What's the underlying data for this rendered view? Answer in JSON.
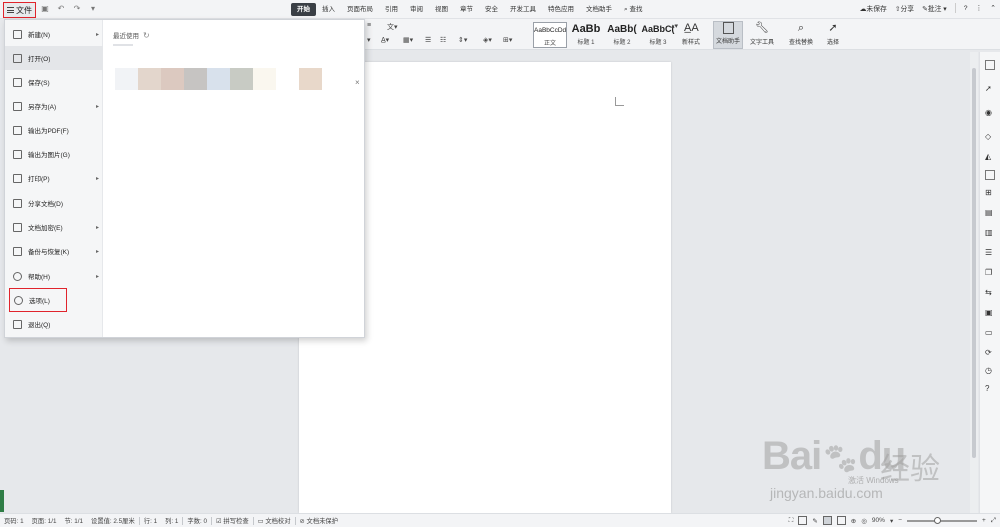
{
  "topbar": {
    "file_label": "文件",
    "tabs": [
      "开始",
      "插入",
      "页面布局",
      "引用",
      "审阅",
      "视图",
      "章节",
      "安全",
      "开发工具",
      "特色应用",
      "文档助手",
      "查找"
    ],
    "active_tab": "开始",
    "unsaved": "未保存",
    "share": "分享",
    "comment": "批注",
    "help": "?",
    "more": "⋮"
  },
  "ribbon": {
    "styles": [
      {
        "preview": "AaBbCcDd",
        "label": "正文"
      },
      {
        "preview": "AaBb",
        "label": "标题 1"
      },
      {
        "preview": "AaBb(",
        "label": "标题 2"
      },
      {
        "preview": "AaBbC(",
        "label": "标题 3"
      }
    ],
    "new_style": "新样式",
    "doc_assistant": "文档助手",
    "text_tools": "文字工具",
    "find_replace": "查找替换",
    "select": "选择"
  },
  "file_menu": {
    "items": [
      {
        "label": "新建(N)",
        "arrow": true
      },
      {
        "label": "打开(O)",
        "arrow": false
      },
      {
        "label": "保存(S)",
        "arrow": false
      },
      {
        "label": "另存为(A)",
        "arrow": true
      },
      {
        "label": "输出为PDF(F)",
        "arrow": false
      },
      {
        "label": "输出为图片(G)",
        "arrow": false
      },
      {
        "label": "打印(P)",
        "arrow": true
      },
      {
        "label": "分享文档(D)",
        "arrow": false
      },
      {
        "label": "文档加密(E)",
        "arrow": true
      },
      {
        "label": "备份与恢复(K)",
        "arrow": true
      },
      {
        "label": "帮助(H)",
        "arrow": true
      },
      {
        "label": "选项(L)",
        "arrow": false
      },
      {
        "label": "退出(Q)",
        "arrow": false
      }
    ],
    "recent_title": "最近使用",
    "swatches": [
      "#f1f3f6",
      "#e3d6cc",
      "#dcc9c0",
      "#c6c4c2",
      "#d8e1ec",
      "#c8cbc4",
      "#faf7ef",
      "#ffffff",
      "#e8d8ca"
    ]
  },
  "status": {
    "page_num": "页码: 1",
    "pages": "页面: 1/1",
    "section": "节: 1/1",
    "setting": "设置值: 2.5厘米",
    "row": "行: 1",
    "col": "列: 1",
    "words": "字数: 0",
    "spell": "拼写检查",
    "proof": "文档校对",
    "protect": "文档未保护",
    "zoom": "90%",
    "minus": "−",
    "plus": "+"
  },
  "watermark": {
    "logo": "Bai",
    "logo2": "du",
    "cn": "经验",
    "url": "jingyan.baidu.com",
    "activate": "激活 Windows"
  }
}
